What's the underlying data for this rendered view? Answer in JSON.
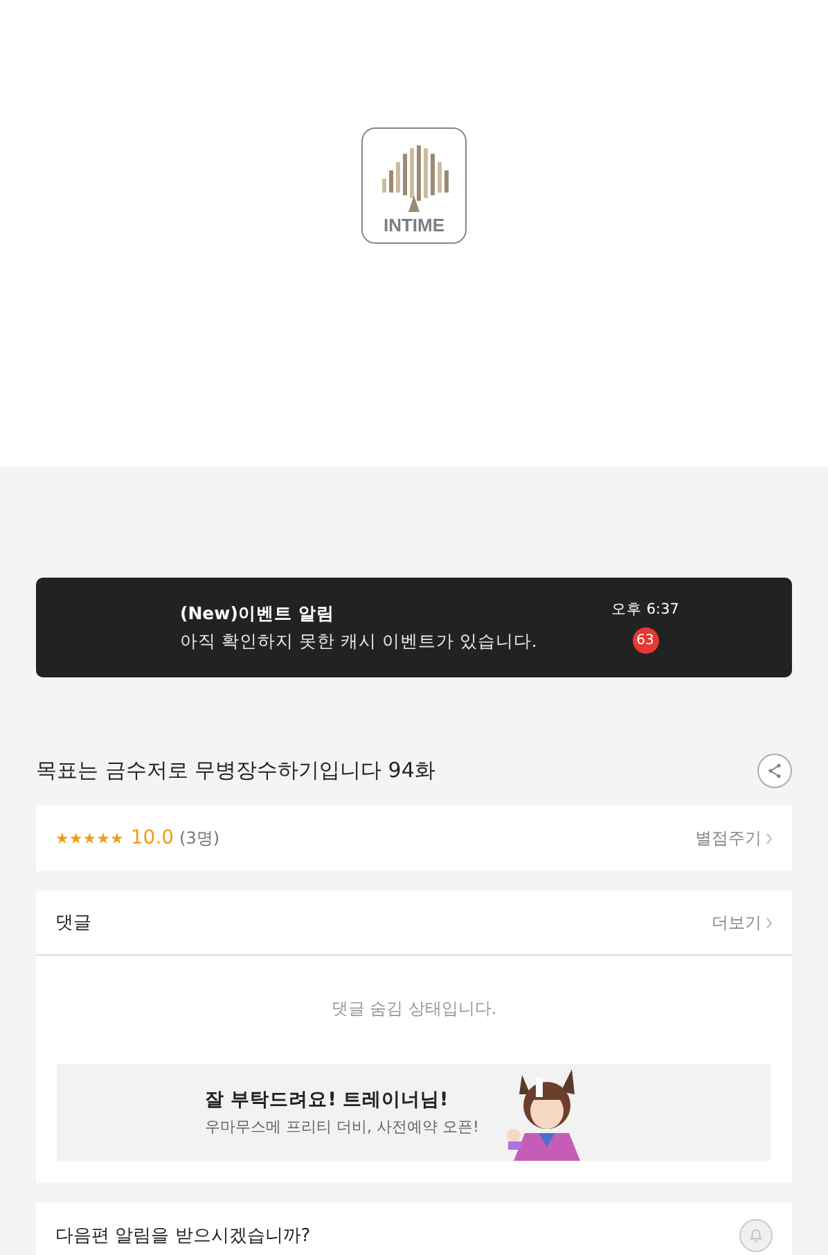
{
  "logo": {
    "text": "INTIME"
  },
  "notification": {
    "title": "(New)이벤트 알림",
    "message": "아직 확인하지 못한 캐시 이벤트가 있습니다.",
    "time": "오후 6:37",
    "badge": "63"
  },
  "episode": {
    "title": "목표는 금수저로 무병장수하기입니다 94화"
  },
  "rating": {
    "stars": 5,
    "score": "10.0",
    "count": "(3명)",
    "action": "별점주기"
  },
  "comments": {
    "title": "댓글",
    "more": "더보기",
    "message": "댓글 숨김 상태입니다."
  },
  "ad": {
    "headline": "잘 부탁드려요! 트레이너님!",
    "subline": "우마무스메 프리티 더비, 사전예약 오픈!",
    "kind": "picture"
  },
  "next_episode": {
    "question": "다음편 알림을 받으시겠습니까?"
  }
}
